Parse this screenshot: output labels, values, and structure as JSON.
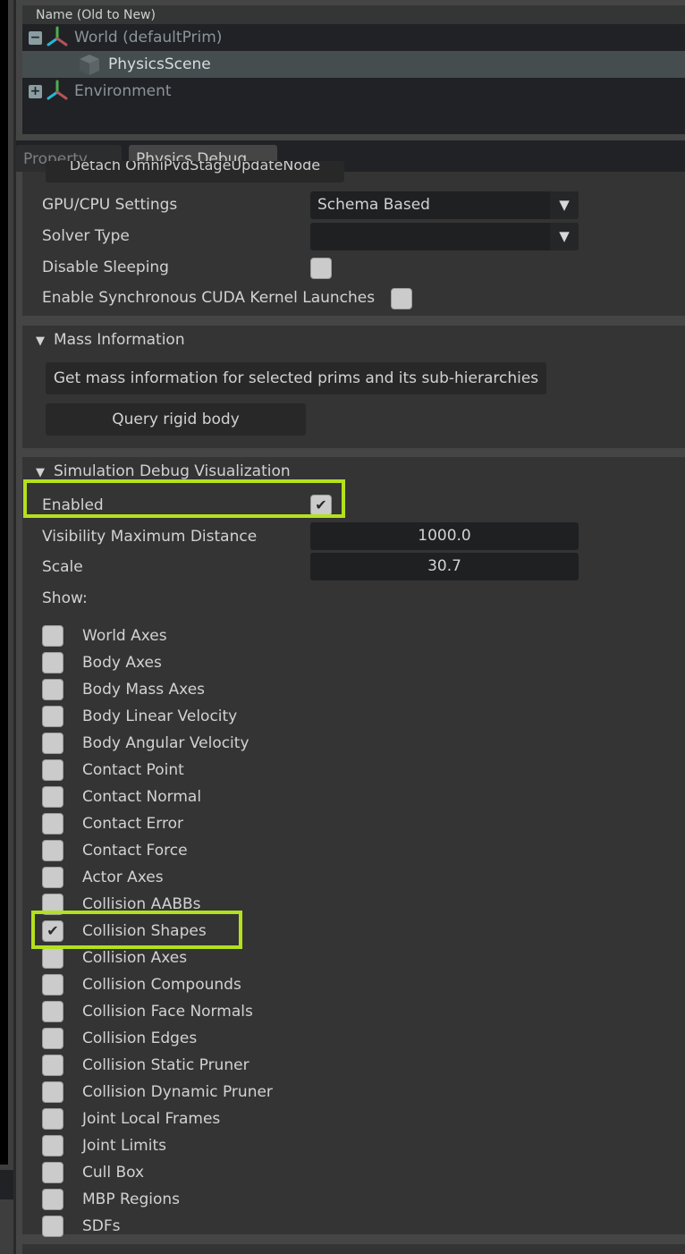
{
  "stage": {
    "column_header": "Name (Old to New)",
    "items": [
      {
        "label": "World (defaultPrim)",
        "expander": "minus",
        "icon": "xform-icon",
        "selected": false
      },
      {
        "label": "PhysicsScene",
        "expander": null,
        "icon": "cube-icon",
        "selected": true
      },
      {
        "label": "Environment",
        "expander": "plus",
        "icon": "xform-icon",
        "selected": false
      }
    ]
  },
  "tabs": [
    {
      "label": "Property",
      "active": false
    },
    {
      "label": "Physics Debug",
      "active": true
    }
  ],
  "settings": {
    "cutoff_button_label": "Detach OmniPvdStageUpdateNode",
    "gpu_cpu": {
      "label": "GPU/CPU Settings",
      "value": "Schema Based",
      "arrow": "▼"
    },
    "solver": {
      "label": "Solver Type",
      "value": "",
      "arrow": "▼"
    },
    "disable_sleeping": {
      "label": "Disable Sleeping",
      "checked": false
    },
    "sync_cuda": {
      "label": "Enable Synchronous CUDA Kernel Launches",
      "checked": false
    }
  },
  "mass": {
    "header": "Mass Information",
    "collapse_glyph": "▼",
    "get_mass_button": "Get mass information for selected prims and its sub-hierarchies",
    "query_button": "Query rigid body"
  },
  "sim_debug": {
    "header": "Simulation Debug Visualization",
    "collapse_glyph": "▼",
    "enabled": {
      "label": "Enabled",
      "checked": true,
      "check_glyph": "✔"
    },
    "visibility_max_distance": {
      "label": "Visibility Maximum Distance",
      "value": "1000.0"
    },
    "scale": {
      "label": "Scale",
      "value": "30.7"
    },
    "show_label": "Show:",
    "show_items": [
      {
        "label": "World Axes",
        "checked": false
      },
      {
        "label": "Body Axes",
        "checked": false
      },
      {
        "label": "Body Mass Axes",
        "checked": false
      },
      {
        "label": "Body Linear Velocity",
        "checked": false
      },
      {
        "label": "Body Angular Velocity",
        "checked": false
      },
      {
        "label": "Contact Point",
        "checked": false
      },
      {
        "label": "Contact Normal",
        "checked": false
      },
      {
        "label": "Contact Error",
        "checked": false
      },
      {
        "label": "Contact Force",
        "checked": false
      },
      {
        "label": "Actor Axes",
        "checked": false
      },
      {
        "label": "Collision AABBs",
        "checked": false
      },
      {
        "label": "Collision Shapes",
        "checked": true
      },
      {
        "label": "Collision Axes",
        "checked": false
      },
      {
        "label": "Collision Compounds",
        "checked": false
      },
      {
        "label": "Collision Face Normals",
        "checked": false
      },
      {
        "label": "Collision Edges",
        "checked": false
      },
      {
        "label": "Collision Static Pruner",
        "checked": false
      },
      {
        "label": "Collision Dynamic Pruner",
        "checked": false
      },
      {
        "label": "Joint Local Frames",
        "checked": false
      },
      {
        "label": "Joint Limits",
        "checked": false
      },
      {
        "label": "Cull Box",
        "checked": false
      },
      {
        "label": "MBP Regions",
        "checked": false
      },
      {
        "label": "SDFs",
        "checked": false
      }
    ]
  },
  "colors": {
    "highlight": "#b4e11d",
    "selected_row": "#454d4f",
    "panel_bg": "#343434",
    "field_bg": "#1f2022"
  }
}
